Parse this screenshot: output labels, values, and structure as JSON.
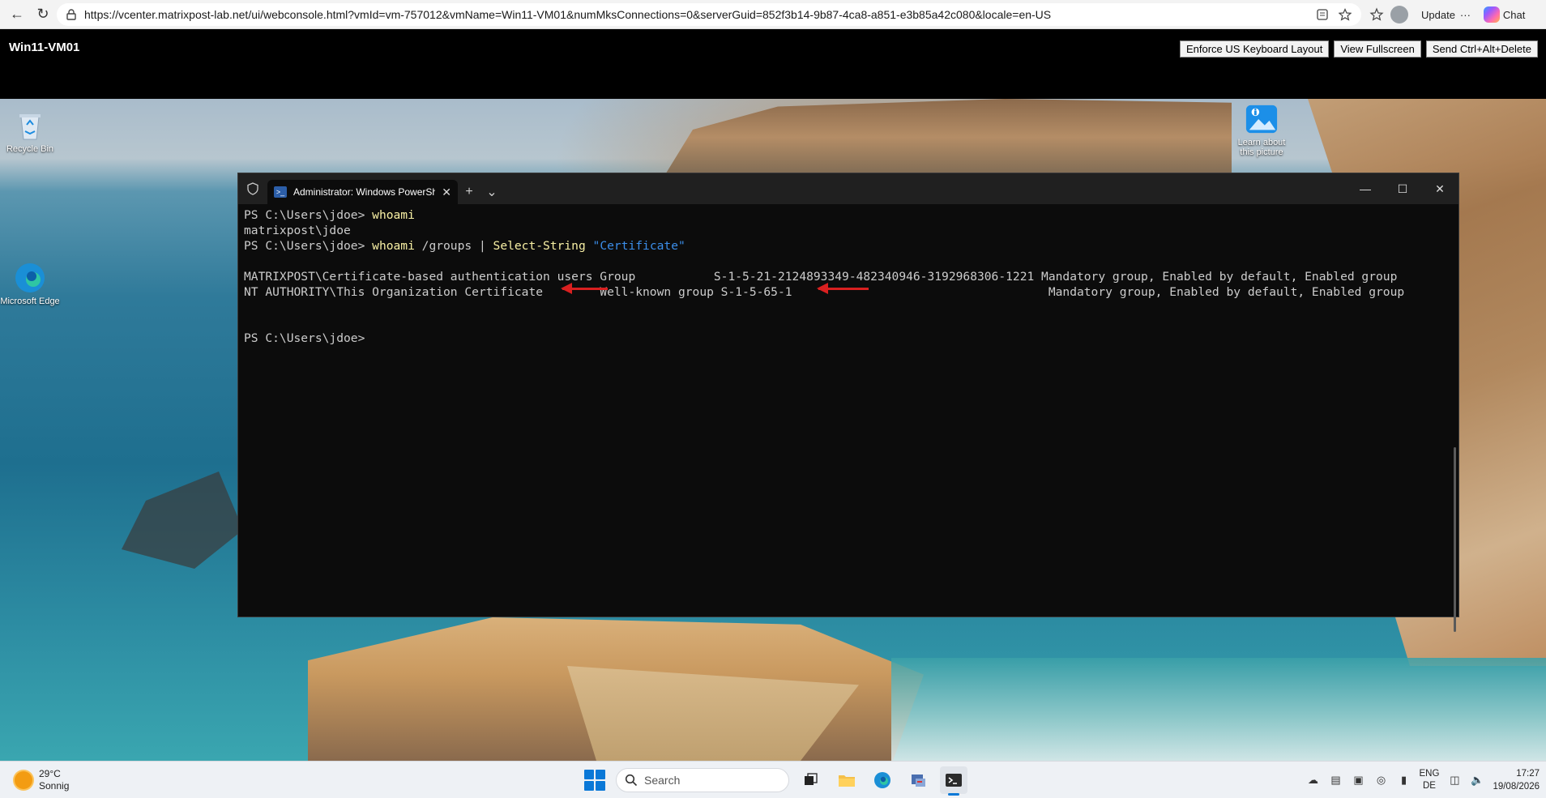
{
  "browser": {
    "url": "https://vcenter.matrixpost-lab.net/ui/webconsole.html?vmId=vm-757012&vmName=Win11-VM01&numMksConnections=0&serverGuid=852f3b14-9b87-4ca8-a851-e3b85a42c080&locale=en-US",
    "update_label": "Update",
    "more_label": "···",
    "chat_label": "Chat"
  },
  "vm": {
    "title": "Win11-VM01",
    "buttons": [
      "Enforce US Keyboard Layout",
      "View Fullscreen",
      "Send Ctrl+Alt+Delete"
    ]
  },
  "desktop": {
    "icons": {
      "recycle_bin": "Recycle Bin",
      "edge": "Microsoft Edge",
      "learn_about": "Learn about this picture"
    }
  },
  "terminal": {
    "tab_title": "Administrator: Windows PowerShell",
    "lines": [
      {
        "prompt": "PS C:\\Users\\jdoe> ",
        "cmd": "whoami",
        "args": "",
        "str": ""
      },
      {
        "output": "matrixpost\\jdoe"
      },
      {
        "prompt": "PS C:\\Users\\jdoe> ",
        "cmd": "whoami",
        "args": " /groups | ",
        "cmd2": "Select-String",
        "str": " \"Certificate\""
      },
      {
        "output": ""
      },
      {
        "output": "MATRIXPOST\\Certificate-based authentication users Group           S-1-5-21-2124893349-482340946-3192968306-1221 Mandatory group, Enabled by default, Enabled group"
      },
      {
        "output": "NT AUTHORITY\\This Organization Certificate        Well-known group S-1-5-65-1                                    Mandatory group, Enabled by default, Enabled group"
      },
      {
        "output": ""
      },
      {
        "output": ""
      },
      {
        "prompt": "PS C:\\Users\\jdoe> ",
        "cmd": "",
        "args": "",
        "str": ""
      }
    ]
  },
  "taskbar": {
    "weather_temp": "29°C",
    "weather_desc": "Sonnig",
    "search_placeholder": "Search",
    "lang_top": "ENG",
    "lang_bottom": "DE",
    "time": "17:27",
    "date": "19/08/2026"
  },
  "colors": {
    "annotation_arrow": "#d92020",
    "terminal_bg": "#0c0c0c",
    "cmd_yellow": "#f9f1a5",
    "string_blue": "#3b8eea"
  }
}
